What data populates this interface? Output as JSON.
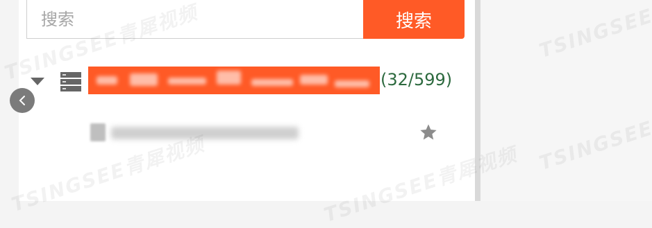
{
  "search": {
    "placeholder": "搜索",
    "button_label": "搜索"
  },
  "tree": {
    "device": {
      "count": "(32/599)",
      "expanded": true,
      "icon": "server-icon"
    },
    "channel": {
      "icon": "camera-icon",
      "favorite_icon": "star-icon"
    }
  },
  "collapse_button": {
    "icon": "chevron-left-icon"
  },
  "colors": {
    "accent": "#ff5a26",
    "count_text": "#2d6a3f"
  },
  "watermark": "TSINGSEE青犀视频"
}
